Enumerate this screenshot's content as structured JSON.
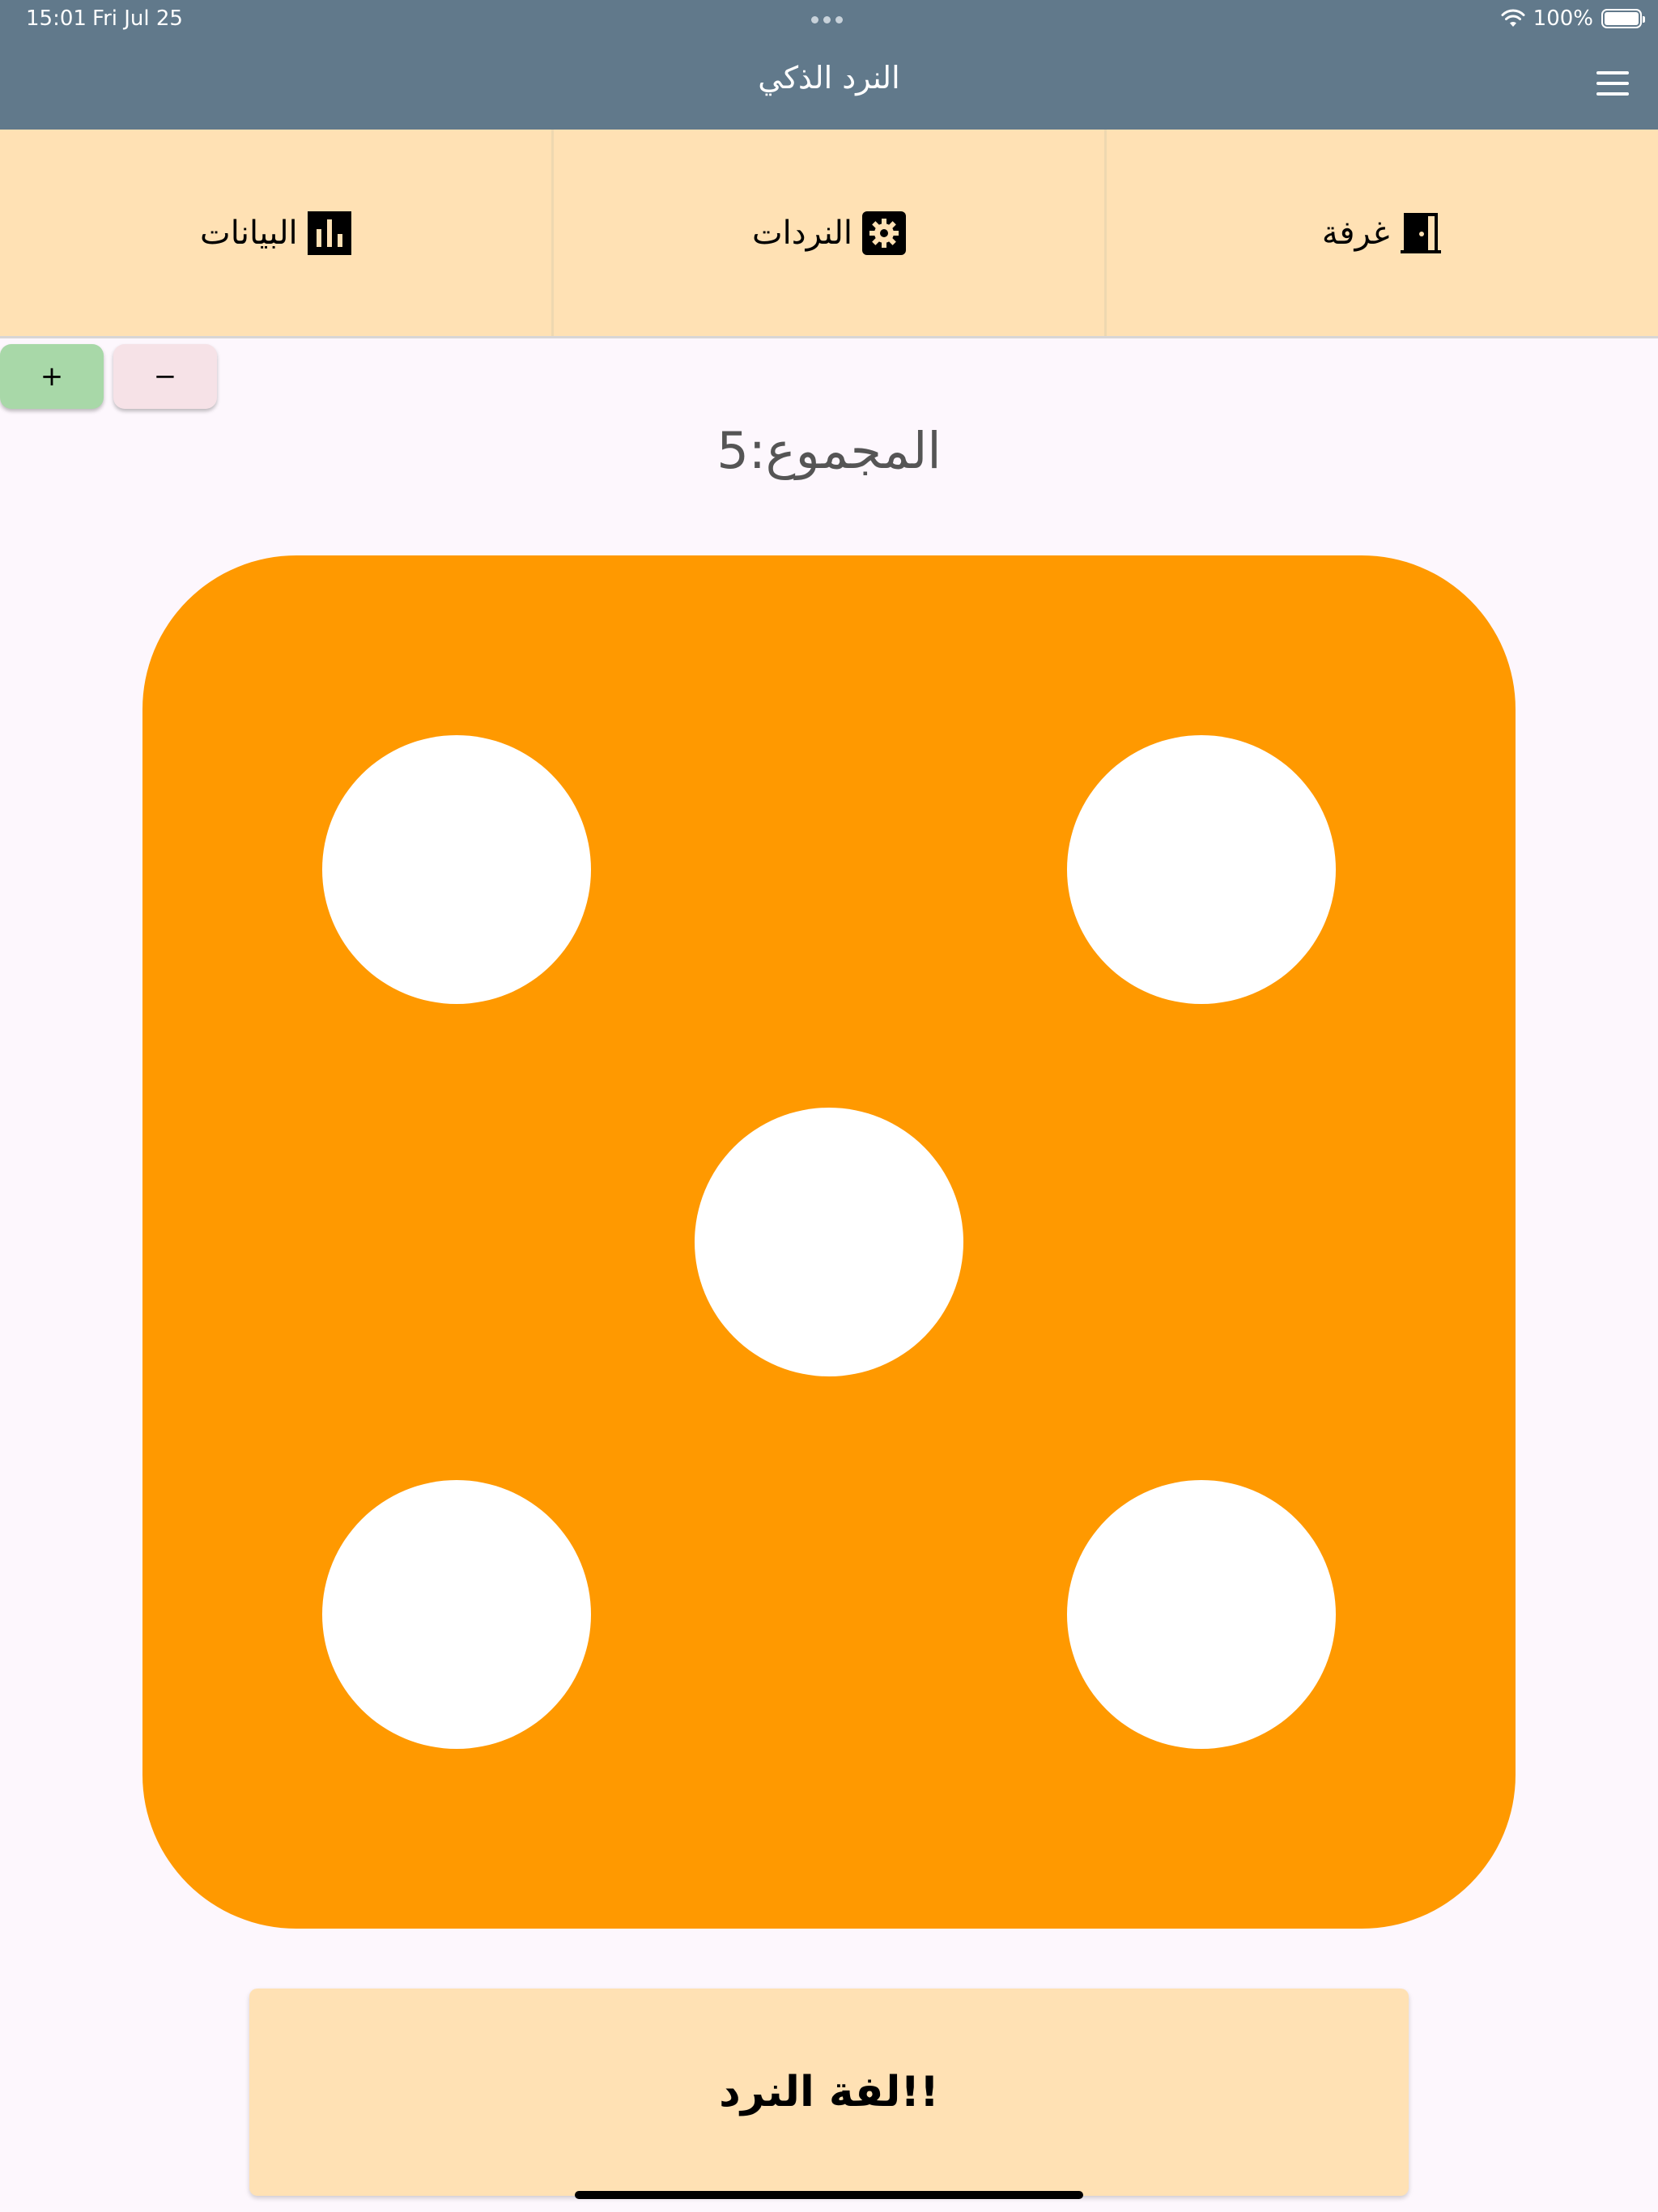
{
  "status_bar": {
    "time": "15:01",
    "date": "Fri Jul 25",
    "battery": "100%"
  },
  "app_bar": {
    "title": "النرد الذكي",
    "menu_icon": "hamburger-menu-icon"
  },
  "tabs": [
    {
      "label": "البيانات",
      "icon": "bar-chart-icon"
    },
    {
      "label": "النردات",
      "icon": "gear-icon"
    },
    {
      "label": "غرفة",
      "icon": "door-icon"
    }
  ],
  "stepper": {
    "plus_label": "+",
    "minus_label": "−"
  },
  "total": {
    "text": "المجموع:5"
  },
  "die": {
    "value": 5,
    "color": "#ff9900",
    "pip_color": "#ffffff"
  },
  "roll_button": {
    "label": "لفة النرد!!"
  },
  "colors": {
    "app_bar": "#61798b",
    "tab_bar": "#ffe1b4",
    "plus": "#a8d8a8",
    "minus": "#f6e2e7",
    "background": "#fdf7fd"
  }
}
